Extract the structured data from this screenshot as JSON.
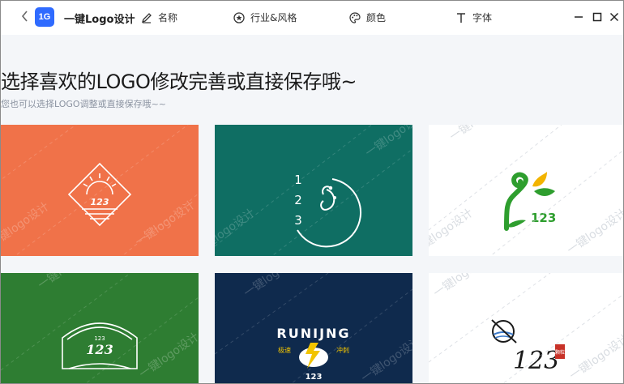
{
  "app": {
    "title": "一键Logo设计",
    "logo_text": "1G"
  },
  "nav": {
    "name_label": "名称",
    "industry_label": "行业&风格",
    "color_label": "颜色",
    "font_label": "字体"
  },
  "main": {
    "heading": "选择喜欢的LOGO修改完善或直接保存哦~",
    "subheading": "您也可以选择LOGO调整或直接保存哦~~"
  },
  "watermark": "一键logo设计",
  "cards": [
    {
      "bg": "#f07249",
      "logo_number": "123",
      "style": "sun-diamond"
    },
    {
      "bg": "#0f6e63",
      "logo_number": "1 2 3",
      "style": "circle-sprout"
    },
    {
      "bg": "#ffffff",
      "logo_number": "123",
      "style": "spiral-leaf"
    },
    {
      "bg": "#2e7d32",
      "logo_number": "123",
      "style": "badge"
    },
    {
      "bg": "#0f2a4d",
      "logo_number": "123",
      "logo_text": "RUNIJNG",
      "left_text": "极速",
      "right_text": "冲刺",
      "style": "runner"
    },
    {
      "bg": "#ffffff",
      "logo_number": "123",
      "seal_text": "颗粒",
      "style": "calligraphy"
    }
  ]
}
